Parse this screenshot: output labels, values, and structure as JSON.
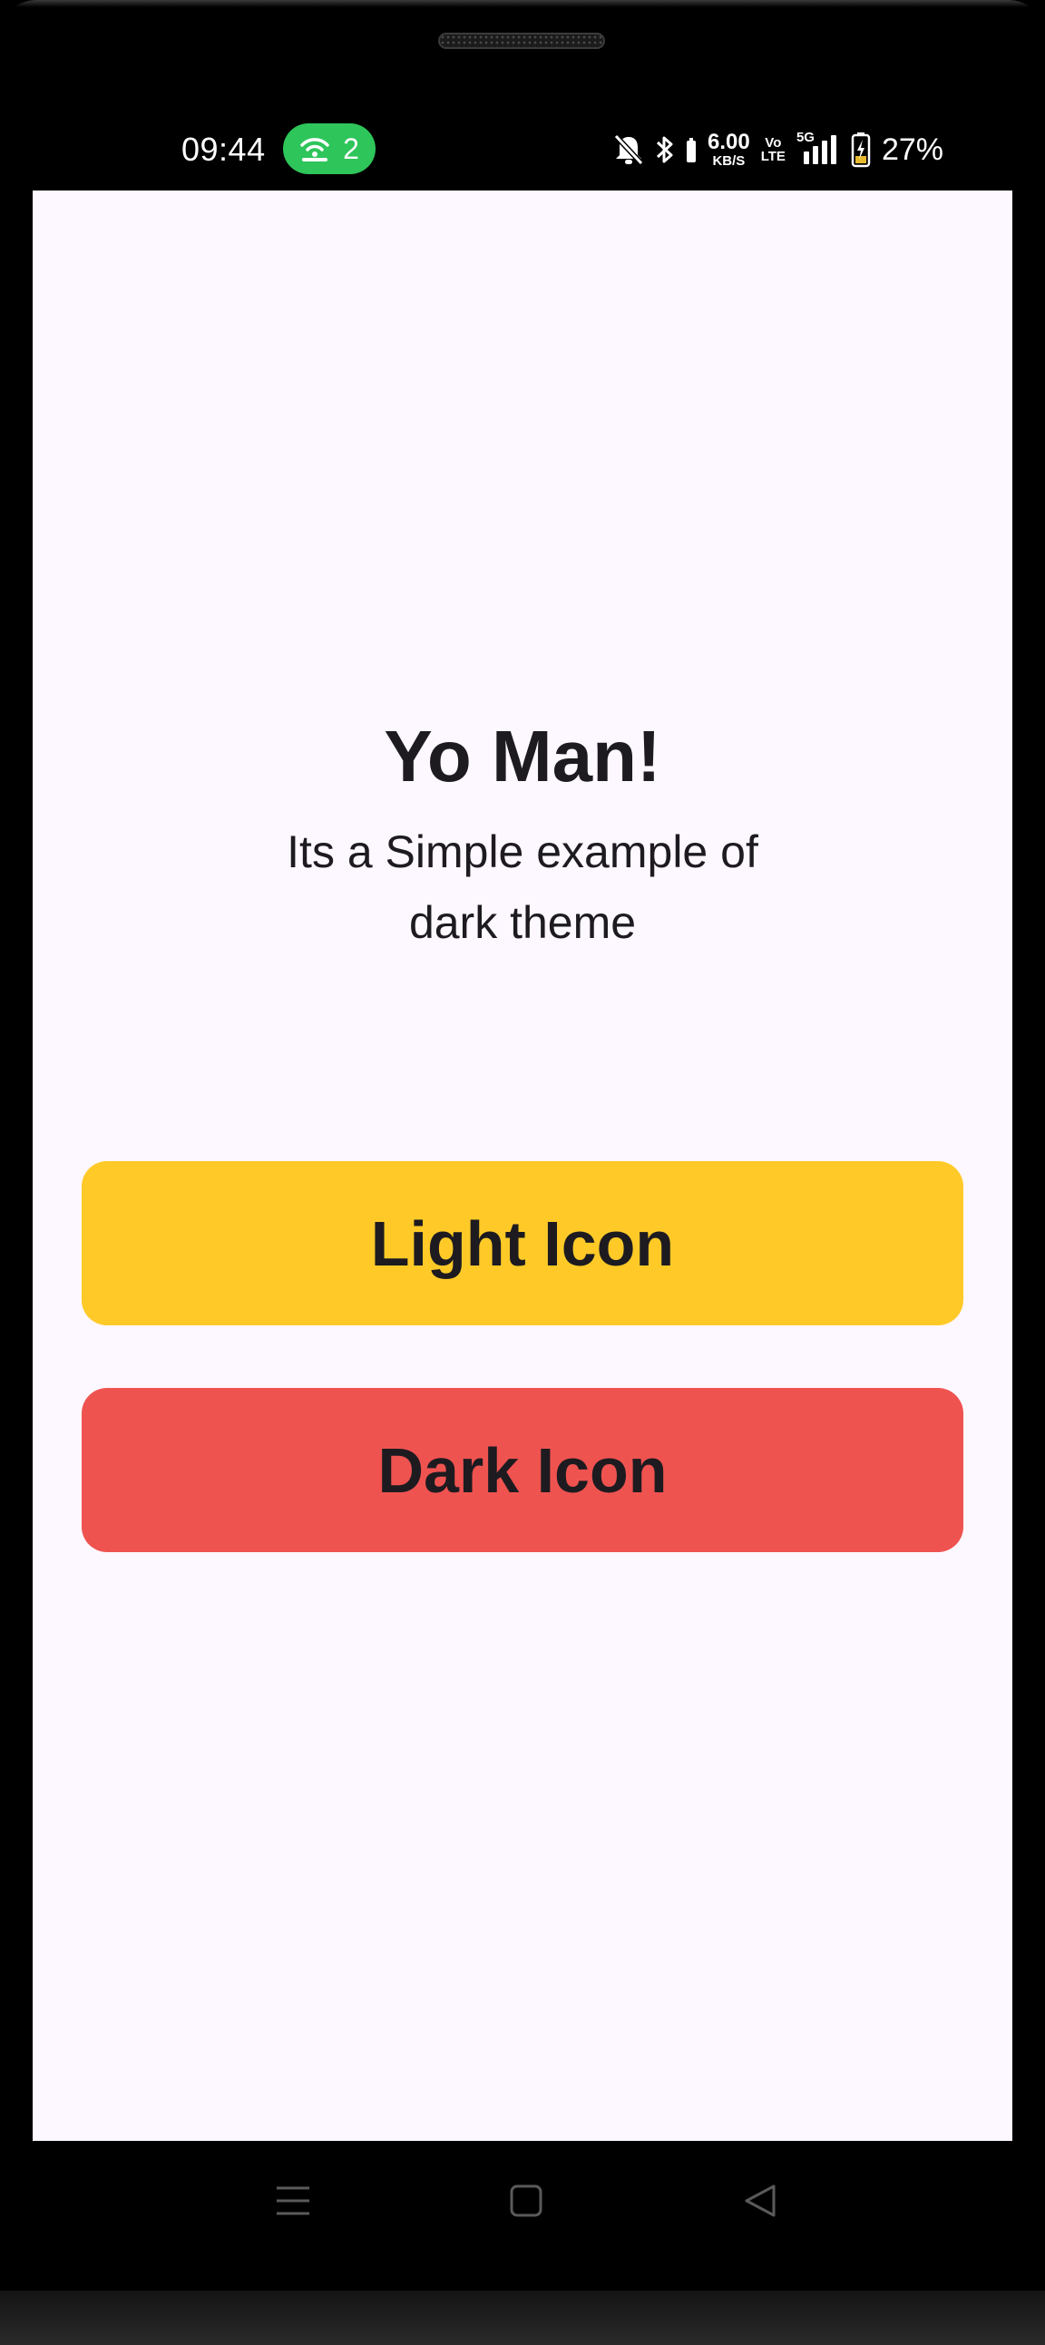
{
  "status_bar": {
    "time": "09:44",
    "hotspot_count": "2",
    "net_speed_value": "6.00",
    "net_speed_unit": "KB/S",
    "volte_top": "Vo",
    "volte_bottom": "LTE",
    "network_type": "5G",
    "battery_percent": "27%",
    "hotspot_color": "#2ec55a"
  },
  "screen": {
    "title": "Yo Man!",
    "subtitle": "Its a Simple example of dark theme",
    "background": "#fdf7ff"
  },
  "buttons": {
    "light_label": "Light Icon",
    "light_color": "#ffca28",
    "dark_label": "Dark Icon",
    "dark_color": "#ef5350"
  },
  "icons": {
    "status": [
      "hotspot-icon",
      "bell-off-icon",
      "bluetooth-icon",
      "signal-icon",
      "battery-charging-icon"
    ],
    "nav": [
      "menu-icon",
      "home-icon",
      "back-icon"
    ]
  }
}
